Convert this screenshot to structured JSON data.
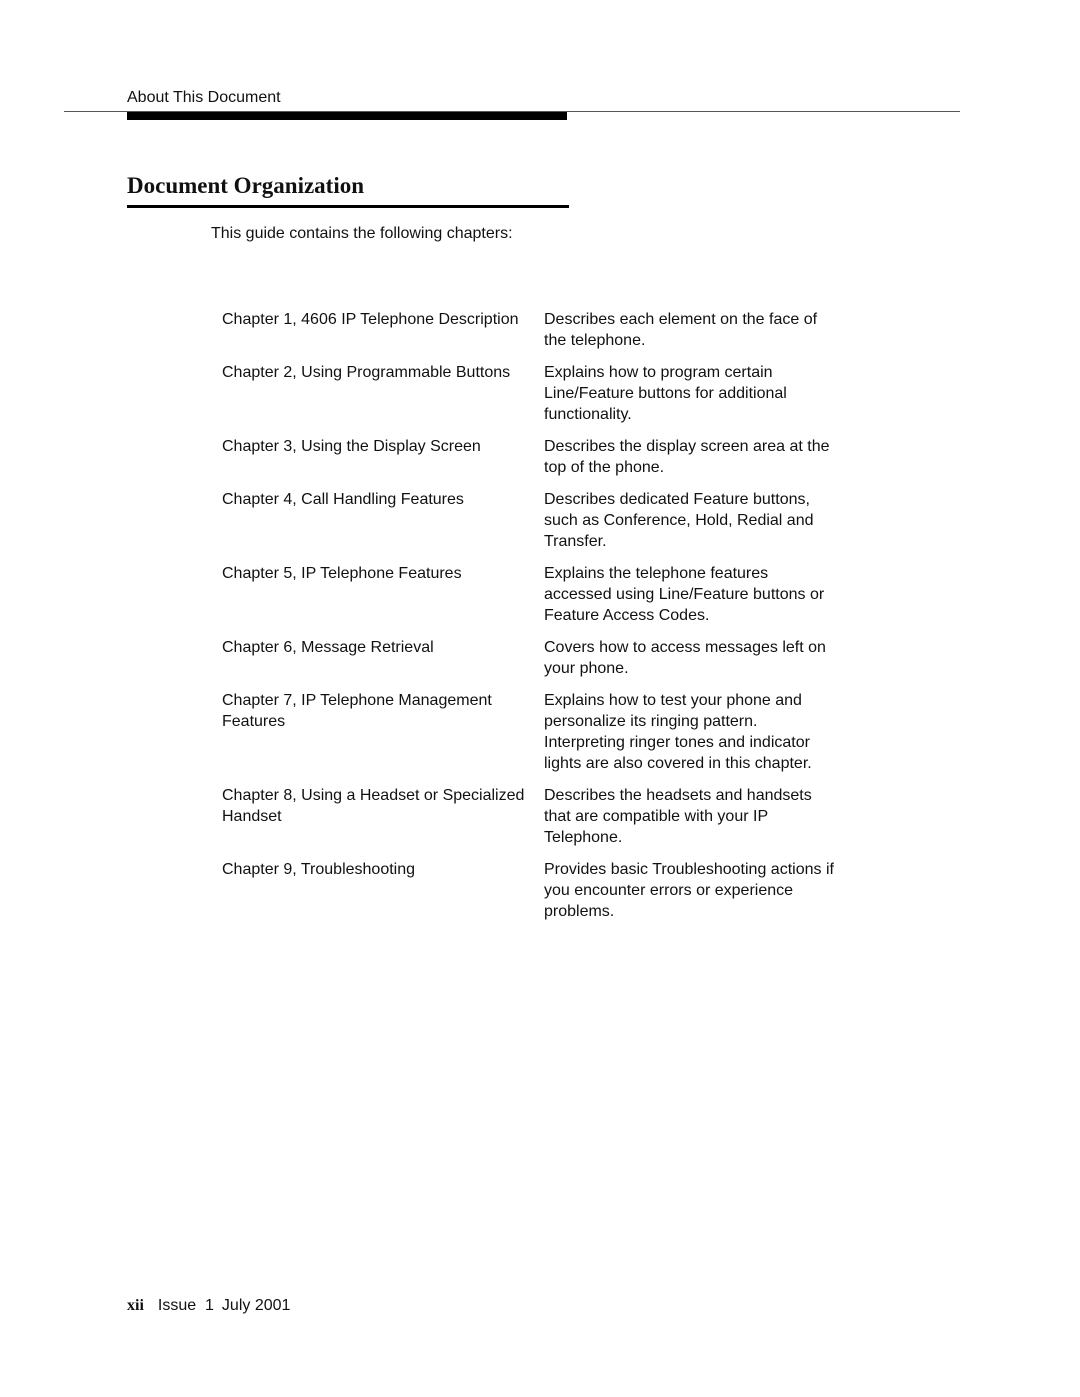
{
  "header": {
    "running_head": "About This Document"
  },
  "section": {
    "title": "Document Organization",
    "intro": "This guide contains the following chapters:"
  },
  "chapters": [
    {
      "title": "Chapter 1, 4606 IP Telephone Description",
      "description": "Describes each element on the face of the telephone."
    },
    {
      "title": "Chapter 2, Using Programmable Buttons",
      "description": "Explains how to program certain Line/Feature buttons for additional functionality."
    },
    {
      "title": "Chapter 3, Using the Display Screen",
      "description": "Describes the display screen area at the top of the phone."
    },
    {
      "title": "Chapter 4, Call Handling Features",
      "description": "Describes dedicated Feature buttons, such as Conference, Hold, Redial and Transfer."
    },
    {
      "title": "Chapter 5, IP Telephone Features",
      "description": "Explains the telephone features accessed using Line/Feature buttons or Feature Access Codes."
    },
    {
      "title": "Chapter 6, Message Retrieval",
      "description": "Covers how to access messages left on your phone."
    },
    {
      "title": "Chapter 7, IP Telephone Management Features",
      "description": "Explains how to test your phone and personalize its ringing pattern. Interpreting ringer tones and indicator lights are also covered in this chapter."
    },
    {
      "title": "Chapter 8, Using a Headset or Specialized Handset",
      "description": "Describes the headsets and handsets that are compatible with your IP Telephone."
    },
    {
      "title": "Chapter 9, Troubleshooting",
      "description": "Provides basic Troubleshooting actions if you encounter errors or experience problems."
    }
  ],
  "footer": {
    "page_number": "xii",
    "issue": "Issue  1",
    "date": "July 2001"
  }
}
